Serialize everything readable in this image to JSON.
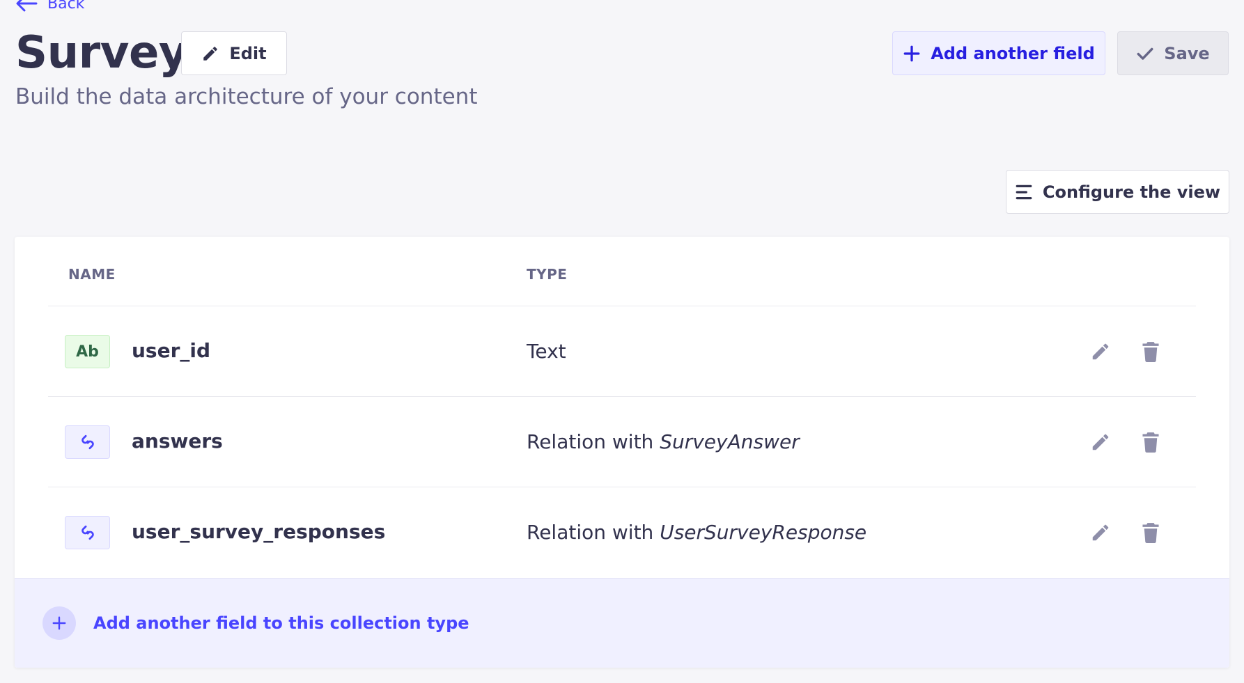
{
  "nav": {
    "back_label": "Back"
  },
  "header": {
    "title": "Survey",
    "edit_label": "Edit",
    "subtitle": "Build the data architecture of your content",
    "add_field_label": "Add another field",
    "save_label": "Save",
    "configure_label": "Configure the view"
  },
  "table": {
    "columns": {
      "name": "NAME",
      "type": "TYPE"
    },
    "rows": [
      {
        "icon": "Ab",
        "icon_kind": "text-icon",
        "name": "user_id",
        "type_prefix": "Text",
        "type_target": ""
      },
      {
        "icon": "",
        "icon_kind": "relation-icon",
        "name": "answers",
        "type_prefix": "Relation with ",
        "type_target": "SurveyAnswer"
      },
      {
        "icon": "",
        "icon_kind": "relation-icon",
        "name": "user_survey_responses",
        "type_prefix": "Relation with ",
        "type_target": "UserSurveyResponse"
      }
    ],
    "footer_label": "Add another field to this collection type"
  },
  "colors": {
    "primary": "#4945ff",
    "background": "#f6f6f9",
    "text": "#32324d",
    "muted": "#666687",
    "icon_gray": "#8e8ea9"
  }
}
